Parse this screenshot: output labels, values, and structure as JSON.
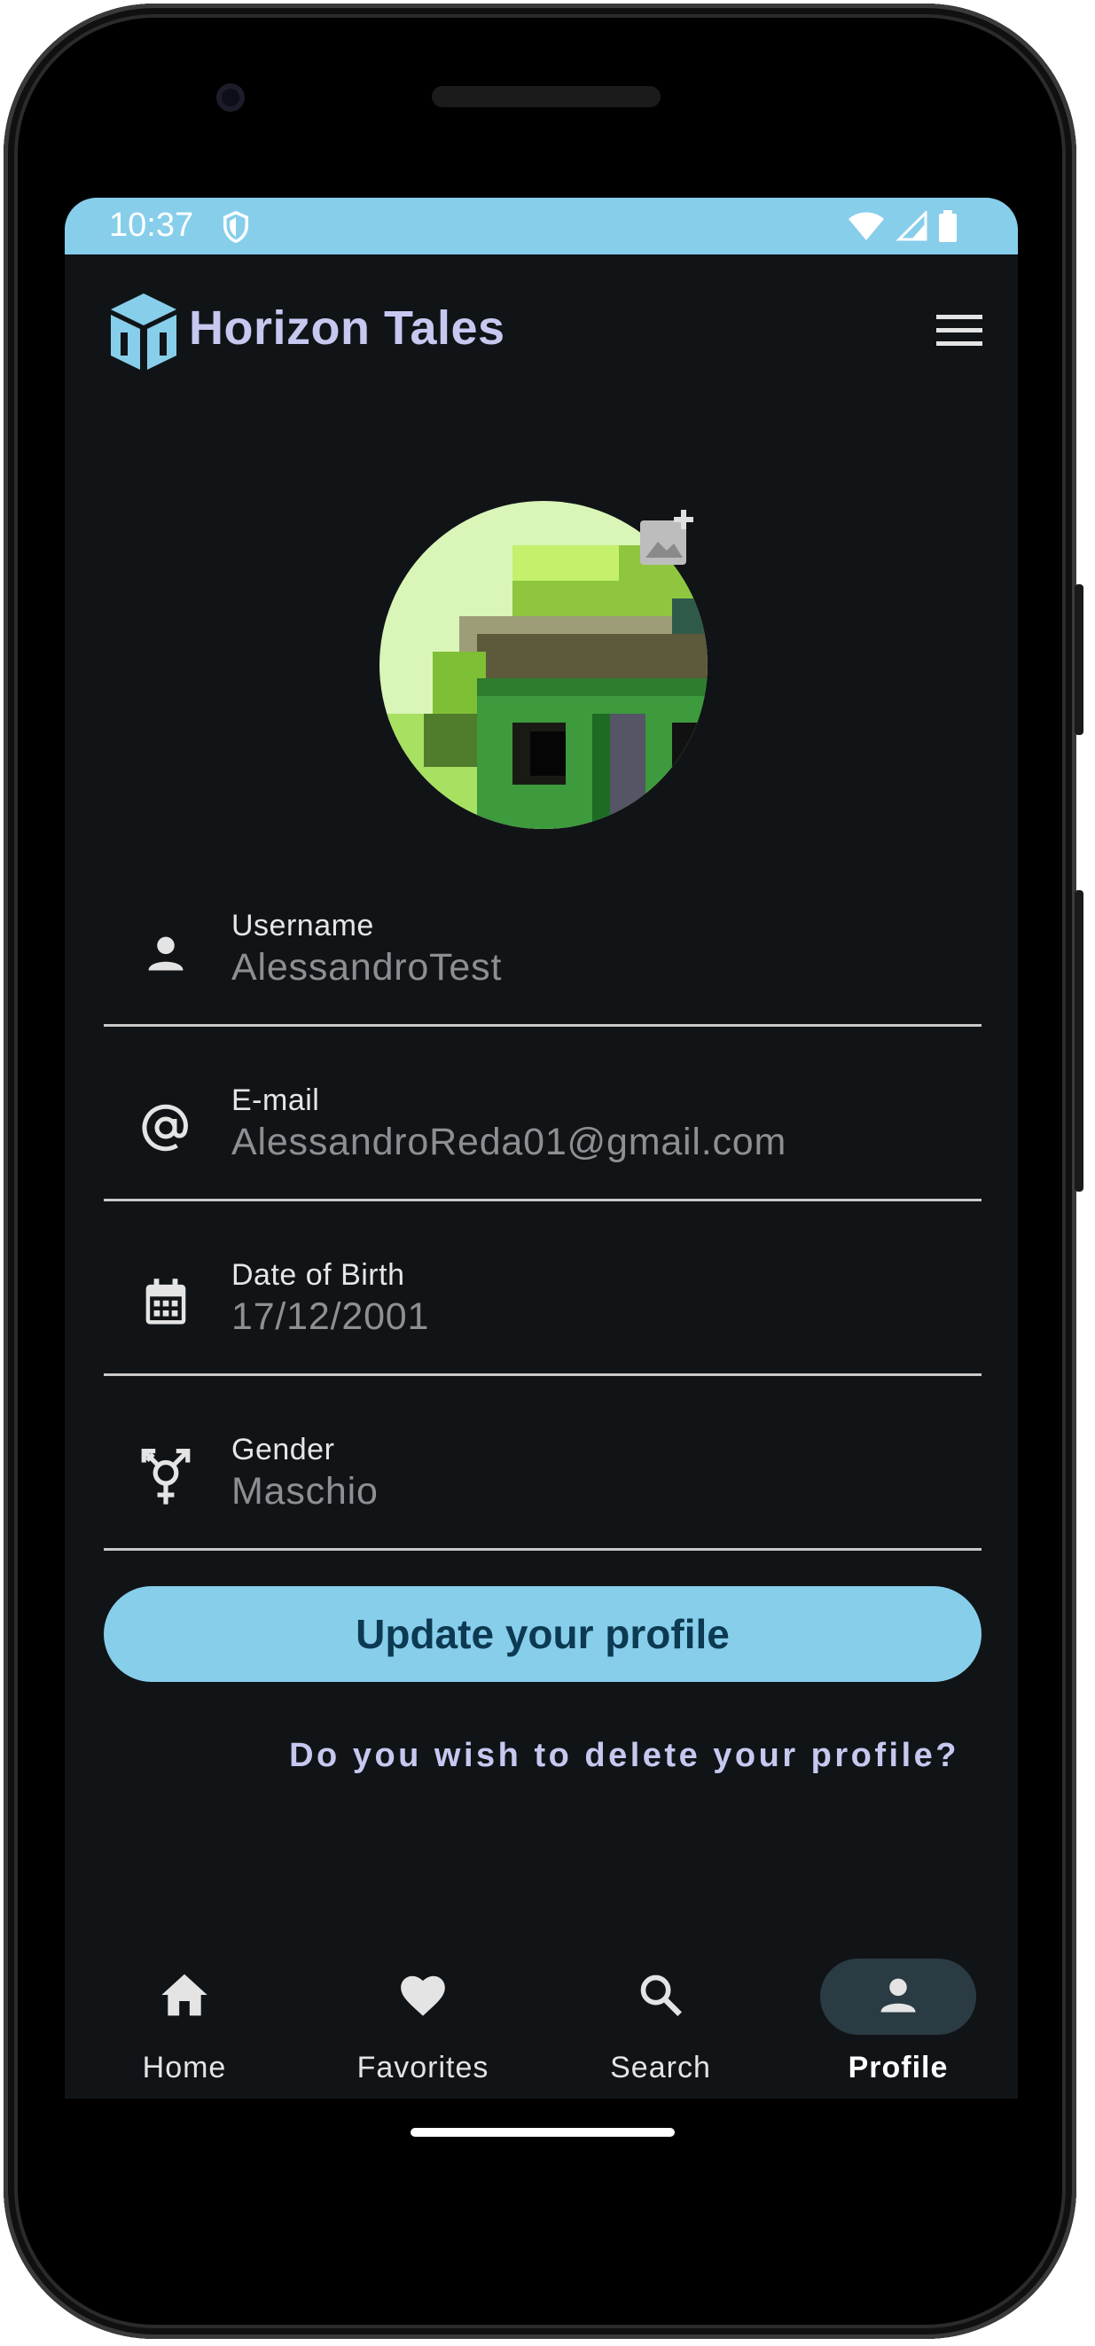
{
  "status_bar": {
    "time": "10:37",
    "icons": [
      "shield-icon",
      "wifi-icon",
      "cellular-signal-icon",
      "battery-icon"
    ]
  },
  "app_bar": {
    "title": "Horizon Tales",
    "logo_icon": "cube-logo-icon",
    "menu_icon": "hamburger-menu-icon"
  },
  "profile": {
    "avatar_icon": "pixel-art-avatar",
    "add_photo_icon": "add-photo-icon",
    "fields": [
      {
        "label": "Username",
        "value": "AlessandroTest",
        "icon": "person-icon"
      },
      {
        "label": "E-mail",
        "value": "AlessandroReda01@gmail.com",
        "icon": "at-sign-icon"
      },
      {
        "label": "Date of Birth",
        "value": "17/12/2001",
        "icon": "calendar-icon"
      },
      {
        "label": "Gender",
        "value": "Maschio",
        "icon": "gender-icon"
      }
    ],
    "update_button": "Update your profile",
    "delete_link": "Do you wish to delete your profile?"
  },
  "bottom_nav": {
    "items": [
      {
        "label": "Home",
        "icon": "home-icon",
        "active": false
      },
      {
        "label": "Favorites",
        "icon": "heart-icon",
        "active": false
      },
      {
        "label": "Search",
        "icon": "search-icon",
        "active": false
      },
      {
        "label": "Profile",
        "icon": "person-icon",
        "active": true
      }
    ]
  },
  "colors": {
    "accent": "#87ceeb",
    "background": "#111417",
    "title": "#c7c8f0",
    "button_text": "#0c3a52",
    "active_nav_pill": "#2a3b44"
  }
}
